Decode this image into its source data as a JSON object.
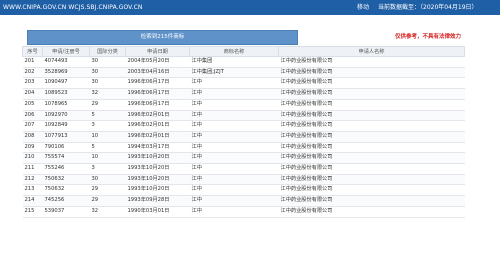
{
  "header": {
    "url_text": "WWW.CNIPA.GOV.CN WCJS.SBJ.CNIPA.GOV.CN",
    "mobile_label": "移动",
    "data_date": "当前数据截至：（2020年04月19日）"
  },
  "summary": {
    "count_label": "检索到215件商标",
    "disclaimer": "仅供参考，不具有法律效力"
  },
  "table": {
    "columns": [
      "序号",
      "申请/注册号",
      "国际分类",
      "申请日期",
      "商标名称",
      "申请人名称"
    ],
    "rows": [
      {
        "seq": "201",
        "reg_no": "4074493",
        "class": "30",
        "date": "2004年05月20日",
        "name": "江中集团",
        "applicant": "江中药业股份有限公司"
      },
      {
        "seq": "202",
        "reg_no": "3528969",
        "class": "30",
        "date": "2003年04月16日",
        "name": "江中集团;JZJT",
        "applicant": "江中药业股份有限公司"
      },
      {
        "seq": "203",
        "reg_no": "1090497",
        "class": "30",
        "date": "1996年06月17日",
        "name": "江中",
        "applicant": "江中药业股份有限公司"
      },
      {
        "seq": "204",
        "reg_no": "1089523",
        "class": "32",
        "date": "1996年06月17日",
        "name": "江中",
        "applicant": "江中药业股份有限公司"
      },
      {
        "seq": "205",
        "reg_no": "1078965",
        "class": "29",
        "date": "1996年06月17日",
        "name": "江中",
        "applicant": "江中药业股份有限公司"
      },
      {
        "seq": "206",
        "reg_no": "1092970",
        "class": "5",
        "date": "1996年02月01日",
        "name": "江中",
        "applicant": "江中药业股份有限公司"
      },
      {
        "seq": "207",
        "reg_no": "1092849",
        "class": "3",
        "date": "1996年02月01日",
        "name": "江中",
        "applicant": "江中药业股份有限公司"
      },
      {
        "seq": "208",
        "reg_no": "1077913",
        "class": "10",
        "date": "1996年02月01日",
        "name": "江中",
        "applicant": "江中药业股份有限公司"
      },
      {
        "seq": "209",
        "reg_no": "790106",
        "class": "5",
        "date": "1994年03月17日",
        "name": "江中",
        "applicant": "江中药业股份有限公司"
      },
      {
        "seq": "210",
        "reg_no": "755574",
        "class": "10",
        "date": "1993年10月20日",
        "name": "江中",
        "applicant": "江中药业股份有限公司"
      },
      {
        "seq": "211",
        "reg_no": "755246",
        "class": "3",
        "date": "1993年10月20日",
        "name": "江中",
        "applicant": "江中药业股份有限公司"
      },
      {
        "seq": "212",
        "reg_no": "750632",
        "class": "30",
        "date": "1993年10月20日",
        "name": "江中",
        "applicant": "江中药业股份有限公司"
      },
      {
        "seq": "213",
        "reg_no": "750632",
        "class": "29",
        "date": "1993年10月20日",
        "name": "江中",
        "applicant": "江中药业股份有限公司"
      },
      {
        "seq": "214",
        "reg_no": "745256",
        "class": "29",
        "date": "1993年09月28日",
        "name": "江中",
        "applicant": "江中药业股份有限公司"
      },
      {
        "seq": "215",
        "reg_no": "539037",
        "class": "32",
        "date": "1990年03月01日",
        "name": "江中",
        "applicant": "江中药业股份有限公司"
      }
    ]
  },
  "colors": {
    "topbar": "#1f5fa6",
    "summary_bar": "#5e92c8",
    "link": "#1b62b4",
    "disclaimer": "#d62020"
  }
}
